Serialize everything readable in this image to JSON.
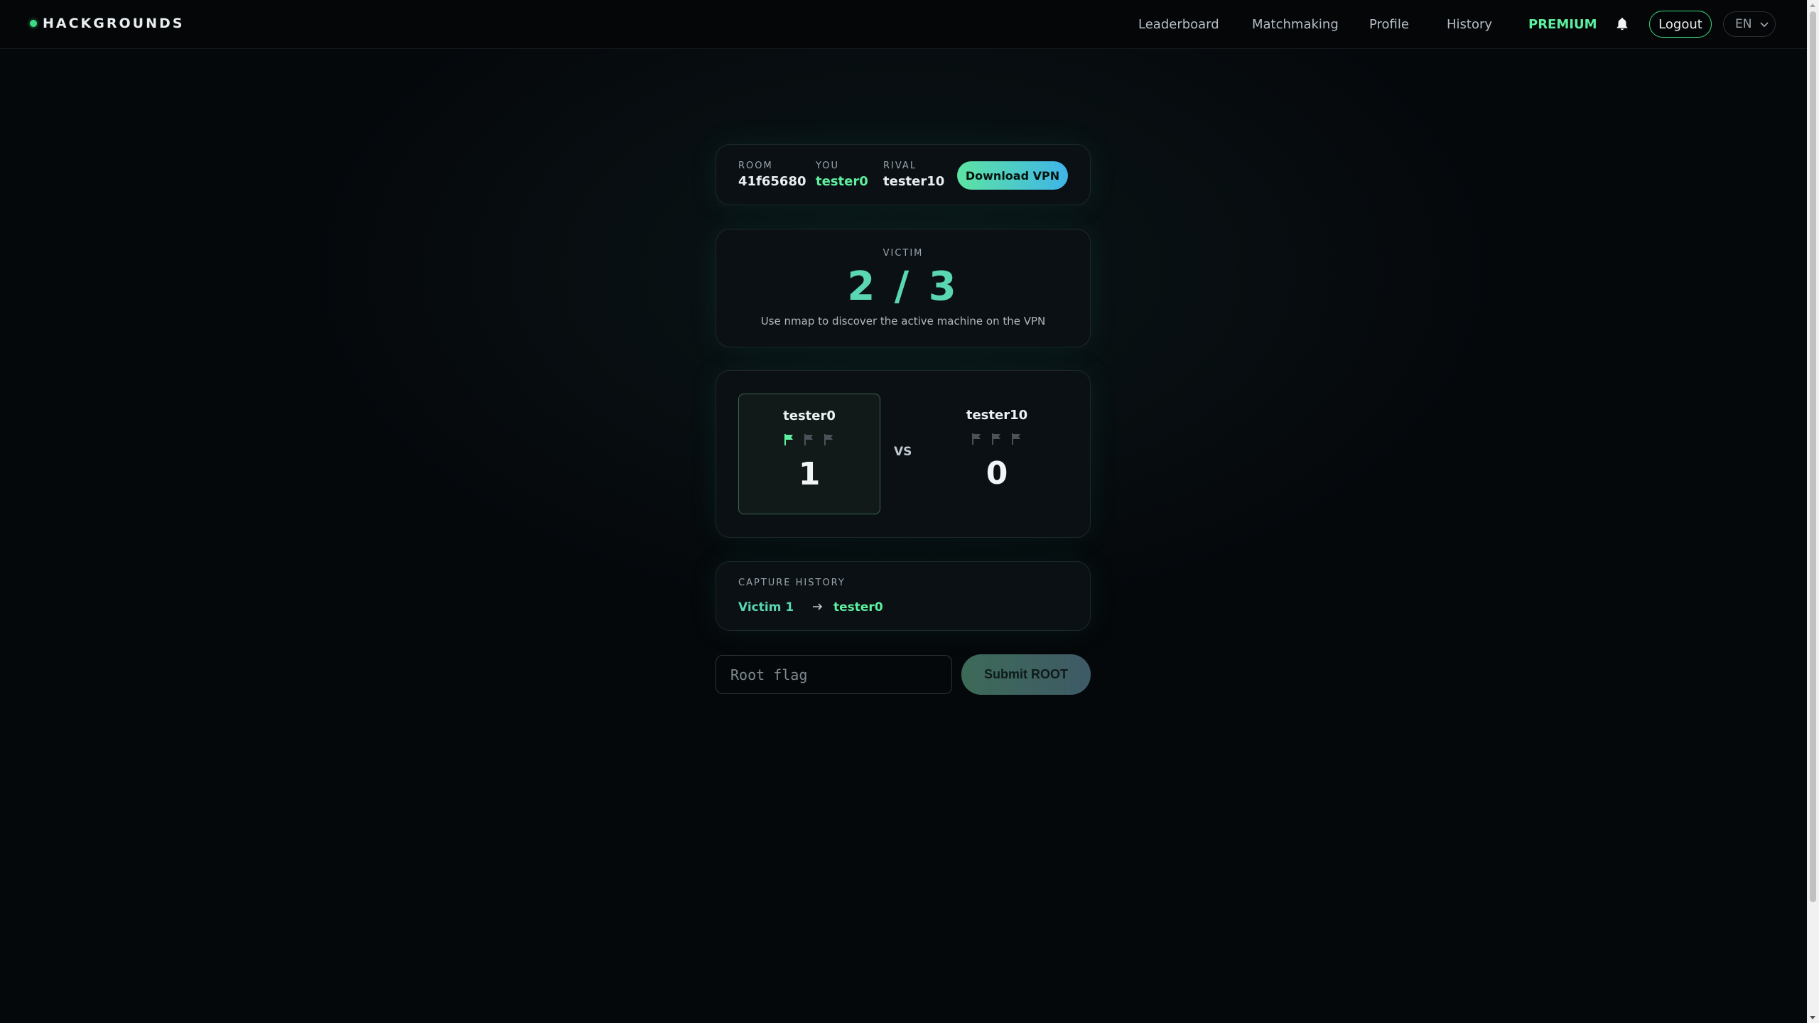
{
  "brand": {
    "name": "HACKGROUNDS"
  },
  "nav": {
    "items": [
      {
        "label": "Leaderboard"
      },
      {
        "label": "Matchmaking"
      },
      {
        "label": "Profile"
      },
      {
        "label": "History"
      },
      {
        "label": "PREMIUM"
      }
    ],
    "logout_label": "Logout",
    "language": "EN"
  },
  "room": {
    "room_label": "ROOM",
    "room_id": "41f65680",
    "you_label": "YOU",
    "you_name": "tester0",
    "rival_label": "RIVAL",
    "rival_name": "tester10",
    "vpn_button": "Download VPN"
  },
  "victim": {
    "label": "VICTIM",
    "progress": "2 / 3",
    "current": 2,
    "total": 3,
    "hint": "Use nmap to discover the active machine on the VPN"
  },
  "scoreboard": {
    "vs_label": "VS",
    "players": [
      {
        "name": "tester0",
        "score": "1",
        "flags_captured": 1,
        "flags_total": 3
      },
      {
        "name": "tester10",
        "score": "0",
        "flags_captured": 0,
        "flags_total": 3
      }
    ]
  },
  "capture_history": {
    "label": "CAPTURE HISTORY",
    "entries": [
      {
        "victim": "Victim 1",
        "user": "tester0"
      }
    ]
  },
  "submit": {
    "placeholder": "Root flag",
    "value": "",
    "button_label": "Submit ROOT"
  },
  "colors": {
    "accent_green": "#5ef0a0",
    "accent_teal": "#5ad6b4",
    "flag_inactive": "#4a5258",
    "background": "#05080b"
  },
  "icons": {
    "bell": "bell-icon",
    "flag": "flag-icon",
    "arrow": "arrow-right-icon",
    "chevron": "chevron-down-icon"
  }
}
